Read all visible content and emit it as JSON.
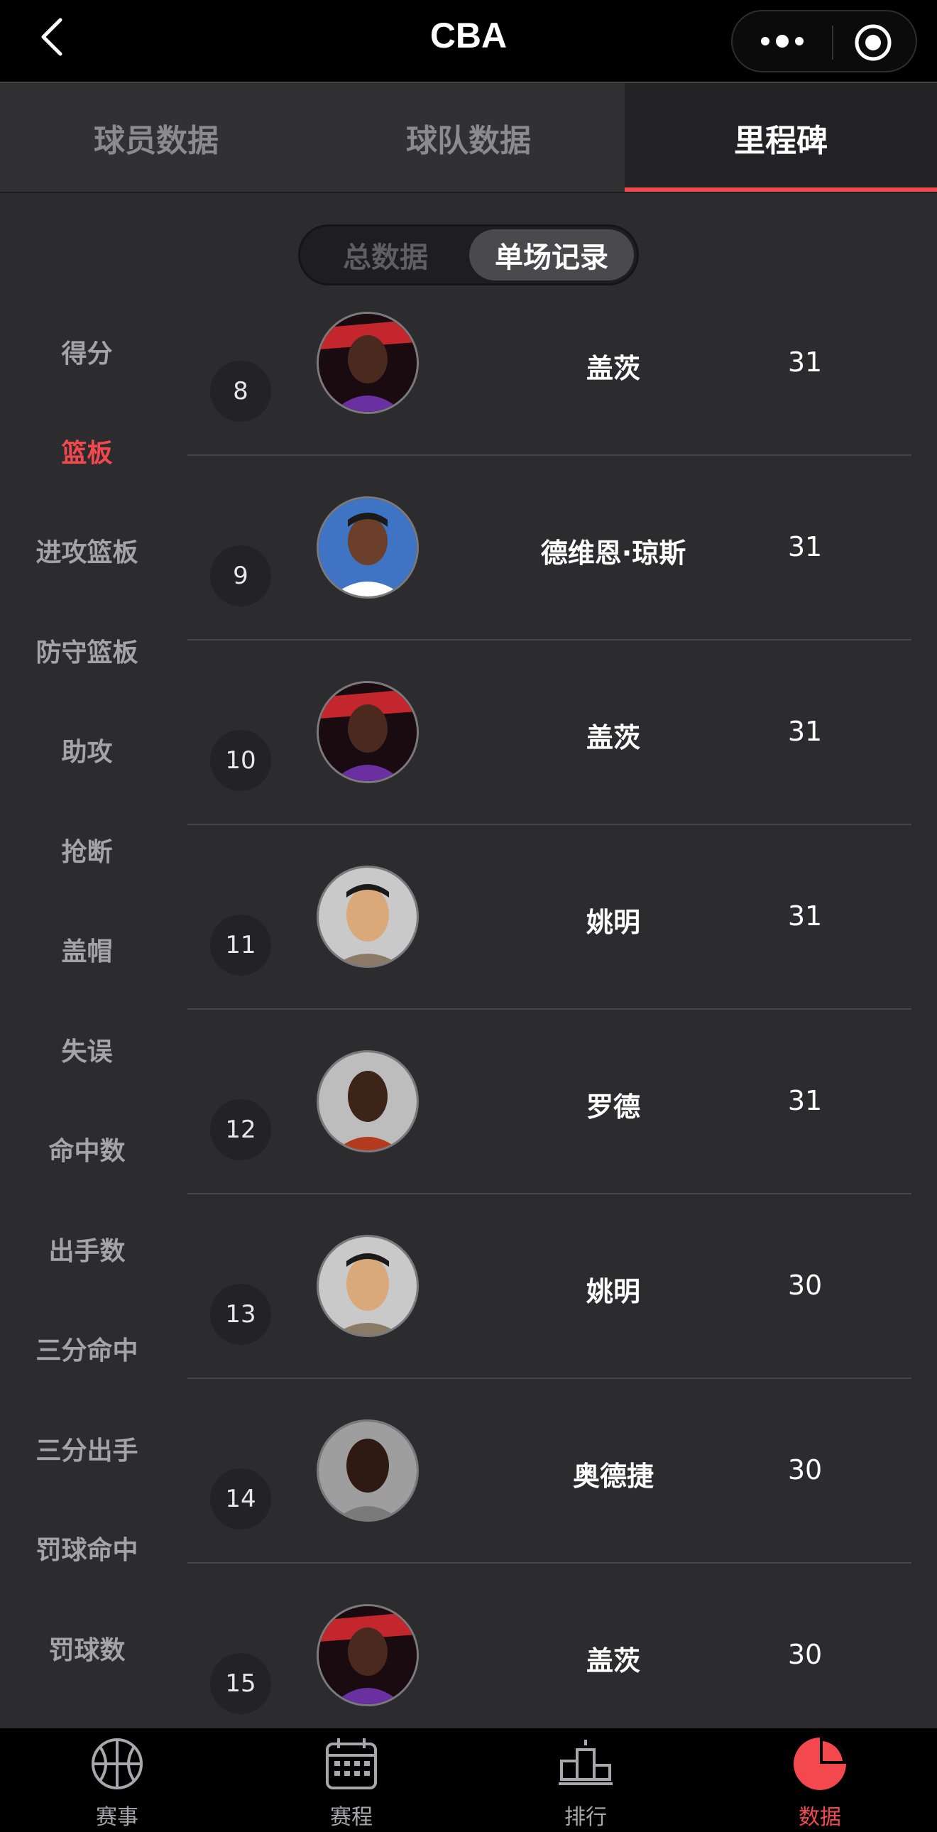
{
  "header": {
    "title": "CBA",
    "back_icon": "chevron-left-icon",
    "more_icon": "more-dots-icon",
    "target_icon": "target-icon"
  },
  "tabs": [
    {
      "label": "球员数据",
      "active": false
    },
    {
      "label": "球队数据",
      "active": false
    },
    {
      "label": "里程碑",
      "active": true
    }
  ],
  "segment": {
    "left_label": "总数据",
    "right_label": "单场记录",
    "selected": "单场记录"
  },
  "sidebar": {
    "items": [
      {
        "label": "得分"
      },
      {
        "label": "篮板"
      },
      {
        "label": "进攻篮板"
      },
      {
        "label": "防守篮板"
      },
      {
        "label": "助攻"
      },
      {
        "label": "抢断"
      },
      {
        "label": "盖帽"
      },
      {
        "label": "失误"
      },
      {
        "label": "命中数"
      },
      {
        "label": "出手数"
      },
      {
        "label": "三分命中"
      },
      {
        "label": "三分出手"
      },
      {
        "label": "罚球命中"
      },
      {
        "label": "罚球数"
      }
    ],
    "active_label": "篮板"
  },
  "records": [
    {
      "rank": "8",
      "name": "盖茨",
      "value": "31",
      "avatar": "player-photo-gates"
    },
    {
      "rank": "9",
      "name": "德维恩·琼斯",
      "value": "31",
      "avatar": "player-photo-jones"
    },
    {
      "rank": "10",
      "name": "盖茨",
      "value": "31",
      "avatar": "player-photo-gates"
    },
    {
      "rank": "11",
      "name": "姚明",
      "value": "31",
      "avatar": "player-photo-yao"
    },
    {
      "rank": "12",
      "name": "罗德",
      "value": "31",
      "avatar": "player-photo-rhodes"
    },
    {
      "rank": "13",
      "name": "姚明",
      "value": "30",
      "avatar": "player-photo-yao"
    },
    {
      "rank": "14",
      "name": "奥德捷",
      "value": "30",
      "avatar": "player-photo-odjie"
    },
    {
      "rank": "15",
      "name": "盖茨",
      "value": "30",
      "avatar": "player-photo-gates"
    }
  ],
  "bottom_nav": [
    {
      "label": "赛事",
      "icon": "basketball-icon",
      "active": false
    },
    {
      "label": "赛程",
      "icon": "calendar-icon",
      "active": false
    },
    {
      "label": "排行",
      "icon": "ranking-podium-icon",
      "active": false
    },
    {
      "label": "数据",
      "icon": "pie-chart-icon",
      "active": true
    }
  ],
  "colors": {
    "accent": "#f2484e",
    "background": "#2c2c2e",
    "header": "#000000"
  }
}
